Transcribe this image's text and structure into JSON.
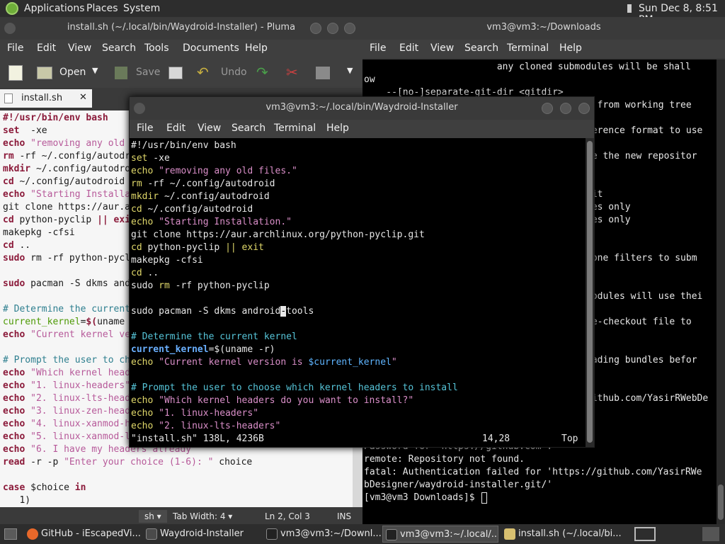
{
  "top_panel": {
    "menus": [
      "Applications",
      "Places",
      "System"
    ],
    "datetime": "Sun Dec 8,  8:51 PM"
  },
  "pluma": {
    "title": "install.sh (~/.local/bin/Waydroid-Installer) - Pluma",
    "menu": [
      "File",
      "Edit",
      "View",
      "Search",
      "Tools",
      "Documents",
      "Help"
    ],
    "toolbar": {
      "open": "Open",
      "save": "Save",
      "undo": "Undo"
    },
    "tab": "install.sh",
    "tab_close": "✕",
    "lines": [
      [
        [
          "kw",
          "#!/usr/bin/env bash"
        ]
      ],
      [
        [
          "kw",
          "set"
        ],
        [
          "",
          "  -xe"
        ]
      ],
      [
        [
          "kw",
          "echo"
        ],
        [
          "str",
          " \"removing any old files.\""
        ]
      ],
      [
        [
          "kw",
          "rm"
        ],
        [
          "",
          " -rf ~/.config/autodroid"
        ]
      ],
      [
        [
          "kw",
          "mkdir"
        ],
        [
          "",
          " ~/.config/autodroid"
        ]
      ],
      [
        [
          "kw",
          "cd"
        ],
        [
          "",
          " ~/.config/autodroid"
        ]
      ],
      [
        [
          "kw",
          "echo"
        ],
        [
          "str",
          " \"Starting Installation.\""
        ]
      ],
      [
        [
          "",
          "git clone https://aur.archlinux.org/python-pyclip.git"
        ]
      ],
      [
        [
          "kw",
          "cd"
        ],
        [
          "",
          " python-pyclip "
        ],
        [
          "kw",
          "||"
        ],
        [
          "kw",
          " exit"
        ]
      ],
      [
        [
          "",
          "makepkg -cfsi"
        ]
      ],
      [
        [
          "kw",
          "cd"
        ],
        [
          "",
          " .."
        ]
      ],
      [
        [
          "kw",
          "sudo"
        ],
        [
          "",
          " rm -rf python-pyclip"
        ]
      ],
      [
        [
          "",
          ""
        ]
      ],
      [
        [
          "kw",
          "sudo"
        ],
        [
          "",
          " pacman -S dkms android-tools"
        ]
      ],
      [
        [
          "",
          ""
        ]
      ],
      [
        [
          "cm",
          "# Determine the current kernel"
        ]
      ],
      [
        [
          "var",
          "current_kernel"
        ],
        [
          "",
          "="
        ],
        [
          "kw",
          "$("
        ],
        [
          "",
          "uname -r)"
        ]
      ],
      [
        [
          "kw",
          "echo"
        ],
        [
          "str",
          " \"Current kernel version is $current_kernel\""
        ]
      ],
      [
        [
          "",
          ""
        ]
      ],
      [
        [
          "cm",
          "# Prompt the user to choose which kernel headers to install"
        ]
      ],
      [
        [
          "kw",
          "echo"
        ],
        [
          "str",
          " \"Which kernel headers do you want to install?\""
        ]
      ],
      [
        [
          "kw",
          "echo"
        ],
        [
          "str",
          " \"1. linux-headers\""
        ]
      ],
      [
        [
          "kw",
          "echo"
        ],
        [
          "str",
          " \"2. linux-lts-headers\""
        ]
      ],
      [
        [
          "kw",
          "echo"
        ],
        [
          "str",
          " \"3. linux-zen-headers\""
        ]
      ],
      [
        [
          "kw",
          "echo"
        ],
        [
          "str",
          " \"4. linux-xanmod-headers\""
        ]
      ],
      [
        [
          "kw",
          "echo"
        ],
        [
          "str",
          " \"5. linux-xanmod-lts-headers\""
        ]
      ],
      [
        [
          "kw",
          "echo"
        ],
        [
          "str",
          " \"6. I have my headers already\""
        ]
      ],
      [
        [
          "kw",
          "read"
        ],
        [
          "",
          " -r -p "
        ],
        [
          "str",
          "\"Enter your choice (1-6): \""
        ],
        [
          "",
          " choice"
        ]
      ],
      [
        [
          "",
          ""
        ]
      ],
      [
        [
          "kw",
          "case"
        ],
        [
          "",
          " $choice "
        ],
        [
          "kw",
          "in"
        ]
      ],
      [
        [
          "",
          "   1)"
        ]
      ]
    ],
    "status": {
      "lang": "sh",
      "tab_width": "Tab Width:  4",
      "position": "Ln 2, Col 3",
      "mode": "INS"
    }
  },
  "bg_terminal": {
    "title": "vm3@vm3:~/Downloads",
    "menu": [
      "File",
      "Edit",
      "View",
      "Search",
      "Terminal",
      "Help"
    ],
    "lines_top": [
      "                        any cloned submodules will be shall",
      "ow",
      "    --[no-]separate-git-dir <gitdir>"
    ],
    "right_fragments": [
      {
        "row": 3,
        "text": "r from working tree"
      },
      {
        "row": 5,
        "text": "ference format to use"
      },
      {
        "row": 7,
        "text": "de the new repositor"
      },
      {
        "row": 9,
        "text": ">"
      },
      {
        "row": 10,
        "text": "mit"
      },
      {
        "row": 11,
        "text": "ses only"
      },
      {
        "row": 12,
        "text": "ses only"
      },
      {
        "row": 13,
        "text": "g"
      },
      {
        "row": 15,
        "text": "lone filters to subm"
      },
      {
        "row": 18,
        "text": "modules will use thei"
      },
      {
        "row": 20,
        "text": "se-checkout file to"
      },
      {
        "row": 23,
        "text": "oading bundles befor"
      },
      {
        "row": 26,
        "text": "github.com/YasirRWebDe"
      }
    ],
    "lines_bottom": [
      "Password for 'https://github.com':",
      "remote: Repository not found.",
      "fatal: Authentication failed for 'https://github.com/YasirRWe",
      "bDesigner/waydroid-installer.git/'",
      "[vm3@vm3 Downloads]$ "
    ]
  },
  "vim_terminal": {
    "title": "vm3@vm3:~/.local/bin/Waydroid-Installer",
    "menu": [
      "File",
      "Edit",
      "View",
      "Search",
      "Terminal",
      "Help"
    ],
    "lines": [
      [
        [
          "",
          "#!/usr/bin/env bash"
        ]
      ],
      [
        [
          "kw",
          "set"
        ],
        [
          "",
          " -xe"
        ]
      ],
      [
        [
          "kw",
          "echo"
        ],
        [
          "str",
          " \"removing any old files.\""
        ]
      ],
      [
        [
          "kw",
          "rm"
        ],
        [
          "",
          " -rf ~/.config/autodroid"
        ]
      ],
      [
        [
          "kw",
          "mkdir"
        ],
        [
          "",
          " ~/.config/autodroid"
        ]
      ],
      [
        [
          "kw",
          "cd"
        ],
        [
          "",
          " ~/.config/autodroid"
        ]
      ],
      [
        [
          "kw",
          "echo"
        ],
        [
          "str",
          " \"Starting Installation.\""
        ]
      ],
      [
        [
          "",
          "git clone https://aur.archlinux.org/python-pyclip.git"
        ]
      ],
      [
        [
          "kw",
          "cd"
        ],
        [
          "",
          " python-pyclip "
        ],
        [
          "kw",
          "||"
        ],
        [
          "kw",
          " exit"
        ]
      ],
      [
        [
          "",
          "makepkg -cfsi"
        ]
      ],
      [
        [
          "kw",
          "cd"
        ],
        [
          "",
          " .."
        ]
      ],
      [
        [
          "",
          "sudo "
        ],
        [
          "kw",
          "rm"
        ],
        [
          "",
          " -rf python-pyclip"
        ]
      ],
      [
        [
          "",
          ""
        ]
      ],
      [
        [
          "",
          "sudo pacman -S dkms android"
        ],
        [
          "cur",
          "-"
        ],
        [
          "",
          "tools"
        ]
      ],
      [
        [
          "",
          ""
        ]
      ],
      [
        [
          "cm",
          "# Determine the current kernel"
        ]
      ],
      [
        [
          "bvar",
          "current_kernel"
        ],
        [
          "",
          "=$(uname -r)"
        ]
      ],
      [
        [
          "kw",
          "echo"
        ],
        [
          "str",
          " \"Current kernel version is "
        ],
        [
          "var",
          "$current_kernel"
        ],
        [
          "str",
          "\""
        ]
      ],
      [
        [
          "",
          ""
        ]
      ],
      [
        [
          "cm",
          "# Prompt the user to choose which kernel headers to install"
        ]
      ],
      [
        [
          "kw",
          "echo"
        ],
        [
          "str",
          " \"Which kernel headers do you want to install?\""
        ]
      ],
      [
        [
          "kw",
          "echo"
        ],
        [
          "str",
          " \"1. linux-headers\""
        ]
      ],
      [
        [
          "kw",
          "echo"
        ],
        [
          "str",
          " \"2. linux-lts-headers\""
        ]
      ]
    ],
    "status": {
      "file": "\"install.sh\" 138L, 4236B",
      "pos": "14,28",
      "scroll": "Top"
    }
  },
  "taskbar": {
    "items": [
      {
        "label": "GitHub - iEscapedVi...",
        "color": "#e8682a"
      },
      {
        "label": "Waydroid-Installer",
        "color": "#3a3a3a"
      },
      {
        "label": "vm3@vm3:~/Downl...",
        "color": "#3a3a3a"
      },
      {
        "label": "vm3@vm3:~/.local/...",
        "color": "#3a3a3a"
      },
      {
        "label": "install.sh (~/.local/bi...",
        "color": "#d8c070"
      }
    ]
  }
}
